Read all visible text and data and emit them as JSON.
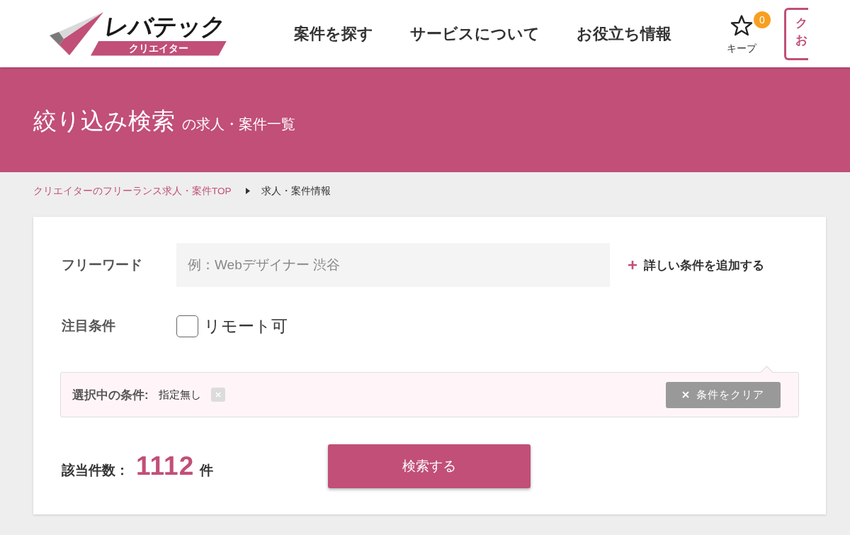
{
  "header": {
    "logo": {
      "wordmark": "レバテック",
      "tagline": "クリエイター"
    },
    "nav": [
      "案件を探す",
      "サービスについて",
      "お役立ち情報"
    ],
    "keep": {
      "label": "キープ",
      "count": "0"
    },
    "edge_button": {
      "lines": [
        "ク",
        "お"
      ]
    }
  },
  "hero": {
    "title": "絞り込み検索",
    "subtitle": "の求人・案件一覧"
  },
  "breadcrumb": [
    {
      "kind": "link",
      "label": "クリエイターのフリーランス求人・案件TOP"
    },
    {
      "kind": "current",
      "label": "求人・案件情報"
    }
  ],
  "search_form": {
    "freeword": {
      "label": "フリーワード",
      "placeholder": "例：Webデザイナー 渋谷"
    },
    "add_conditions_link": "詳しい条件を追加する",
    "featured": {
      "label": "注目条件",
      "options": [
        {
          "label": "リモート可",
          "checked": false
        }
      ]
    },
    "selected_conditions": {
      "label": "選択中の条件:",
      "chips": [
        "指定無し"
      ],
      "clear_button": "条件をクリア"
    },
    "result": {
      "label": "該当件数：",
      "count": "1112",
      "unit": "件"
    },
    "submit_button": "検索する"
  }
}
